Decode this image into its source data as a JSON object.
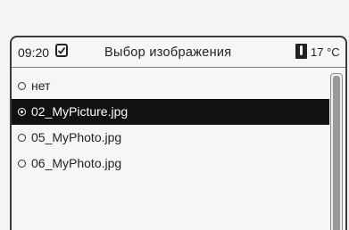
{
  "header": {
    "time": "09:20",
    "clock_icon": "clock-icon",
    "title": "Выбор изображения",
    "temp_icon": "thermometer-icon",
    "temperature": "17 °C"
  },
  "list": {
    "items": [
      {
        "label": "нет",
        "selected": false
      },
      {
        "label": "02_MyPicture.jpg",
        "selected": true
      },
      {
        "label": "05_MyPhoto.jpg",
        "selected": false
      },
      {
        "label": "06_MyPhoto.jpg",
        "selected": false
      }
    ]
  },
  "colors": {
    "selected_bg": "#111111",
    "selected_fg": "#ffffff",
    "text": "#222222"
  }
}
